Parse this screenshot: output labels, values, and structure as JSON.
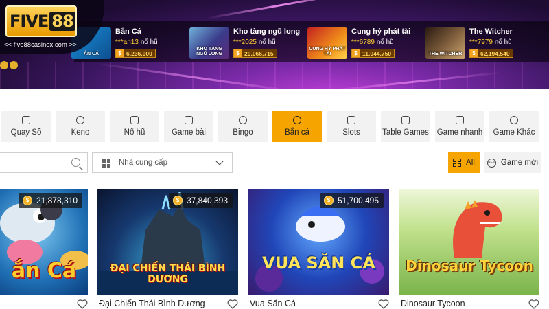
{
  "brand": {
    "logo_text": "FIVE",
    "logo_number": "88",
    "url": "<< five88casinox.com >>"
  },
  "ticker": [
    {
      "name": "Bắn Cá",
      "player": "***an13",
      "action": "nổ hũ",
      "amount": "6,236,000",
      "thumb_label": "ẮN CÁ"
    },
    {
      "name": "Kho tàng ngũ long",
      "player": "***2025",
      "action": "nổ hũ",
      "amount": "20,066,715",
      "thumb_label": "KHO TÀNG NGŨ LONG"
    },
    {
      "name": "Cung hỷ phát tài",
      "player": "***6789",
      "action": "nổ hũ",
      "amount": "11,044,750",
      "thumb_label": "CUNG HỶ PHÁT TÀI"
    },
    {
      "name": "The Witcher",
      "player": "***7979",
      "action": "nổ hũ",
      "amount": "62,194,540",
      "thumb_label": "THE WITCHER"
    }
  ],
  "categories": [
    {
      "label": "Quay Số",
      "icon": "lottery-icon"
    },
    {
      "label": "Keno",
      "icon": "keno-balls-icon"
    },
    {
      "label": "Nổ hũ",
      "icon": "slot-jar-icon"
    },
    {
      "label": "Game bài",
      "icon": "cards-icon"
    },
    {
      "label": "Bingo",
      "icon": "bingo-ball-icon"
    },
    {
      "label": "Bắn cá",
      "icon": "fish-shooting-icon",
      "active": true
    },
    {
      "label": "Slots",
      "icon": "slot-machine-icon"
    },
    {
      "label": "Table Games",
      "icon": "table-icon"
    },
    {
      "label": "Game nhanh",
      "icon": "quick-game-icon"
    },
    {
      "label": "Game Khác",
      "icon": "other-games-icon"
    }
  ],
  "filters": {
    "search_placeholder": "",
    "provider_placeholder": "Nhà cung cấp",
    "all_label": "All",
    "new_label": "Game mới",
    "new_icon_text": "NEW"
  },
  "games": [
    {
      "title": "",
      "jackpot": "21,878,310",
      "art": "ắn Cá"
    },
    {
      "title": "Đại Chiến Thái Bình Dương",
      "jackpot": "37,840,393",
      "art": "ĐẠI CHIẾN THÁI BÌNH DƯƠNG"
    },
    {
      "title": "Vua Săn Cá",
      "jackpot": "51,700,495",
      "art": "VUA SĂN CÁ"
    },
    {
      "title": "Dinosaur Tycoon",
      "jackpot": "",
      "art": "Dinosaur Tycoon"
    }
  ],
  "colors": {
    "accent": "#f5a400",
    "tab_bg": "#f2f2f2",
    "banner": "#5b1e83"
  }
}
